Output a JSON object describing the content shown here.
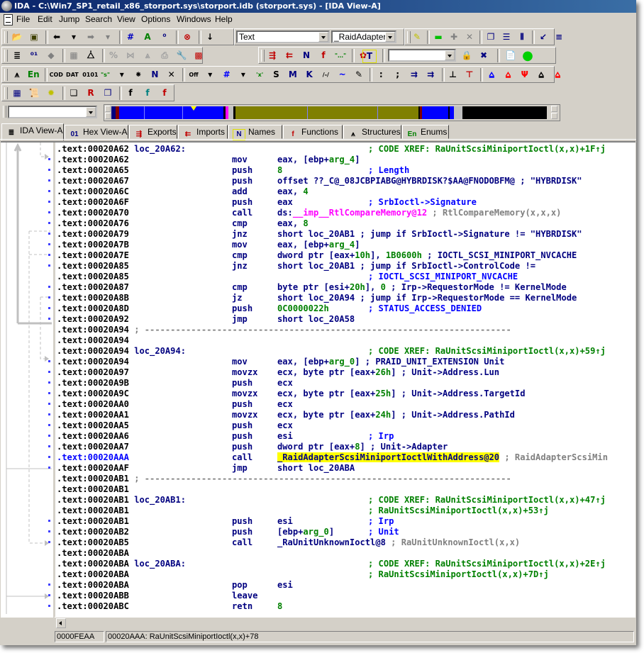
{
  "window": {
    "title": "IDA - C:\\Win7_SP1_retail_x86_storport.sys\\storport.idb (storport.sys) - [IDA View-A]"
  },
  "menu": [
    "File",
    "Edit",
    "Jump",
    "Search",
    "View",
    "Options",
    "Windows",
    "Help"
  ],
  "toolbar": {
    "row1": [
      {
        "name": "open-file-icon",
        "glyph": "📂",
        "color": "#c0a000"
      },
      {
        "name": "save-icon",
        "glyph": "▣",
        "color": "#404000"
      },
      {
        "name": "back-icon",
        "glyph": "⬅",
        "color": "#000000"
      },
      {
        "name": "back-dropdown-icon",
        "glyph": "▾",
        "color": "#000000"
      },
      {
        "name": "forward-icon",
        "glyph": "➡",
        "color": "#808080"
      },
      {
        "name": "forward-dropdown-icon",
        "glyph": "▾",
        "color": "#808080"
      },
      {
        "name": "search-text-icon",
        "glyph": "#",
        "color": "#0000c0"
      },
      {
        "name": "search-next-text-icon",
        "glyph": "A",
        "color": "#008000"
      },
      {
        "name": "search-binary-icon",
        "glyph": "⁰",
        "color": "#000080"
      },
      {
        "name": "search-immediate-icon",
        "glyph": "⊗",
        "color": "#c00000"
      },
      {
        "name": "jump-down-icon",
        "glyph": "↓",
        "color": "#000000"
      },
      {
        "name": "highlight-icon",
        "glyph": "✎",
        "color": "#c0c000"
      },
      {
        "name": "collapse-icon",
        "glyph": "▬",
        "color": "#00c000"
      },
      {
        "name": "expand-icon",
        "glyph": "✚",
        "color": "#808080"
      },
      {
        "name": "close-view-icon",
        "glyph": "✕",
        "color": "#808080"
      },
      {
        "name": "cascade-windows-icon",
        "glyph": "❐",
        "color": "#000080"
      },
      {
        "name": "tile-horizontal-icon",
        "glyph": "☰",
        "color": "#000080"
      },
      {
        "name": "tile-vertical-icon",
        "glyph": "⫴",
        "color": "#000080"
      },
      {
        "name": "window-arrow-icon",
        "glyph": "↙",
        "color": "#000080"
      },
      {
        "name": "list-icon",
        "glyph": "≡",
        "color": "#000080"
      }
    ],
    "row1_combo1": "Text",
    "row1_combo2": "_RaidAdapterS",
    "row2": [
      {
        "name": "disassembly-view-icon",
        "glyph": "≣",
        "color": "#000000"
      },
      {
        "name": "hex-view-icon",
        "glyph": "⁰¹",
        "color": "#000080"
      },
      {
        "name": "graph-node-icon",
        "glyph": "◆",
        "color": "#808080"
      },
      {
        "name": "flow-chart-icon",
        "glyph": "▦",
        "color": "#808080"
      },
      {
        "name": "call-graph-icon",
        "glyph": "⧊",
        "color": "#000000"
      },
      {
        "name": "percent-icon",
        "glyph": "%",
        "color": "#a0a0a0"
      },
      {
        "name": "xrefs-icon",
        "glyph": "⋈",
        "color": "#a0a0a0"
      },
      {
        "name": "tree-icon",
        "glyph": "⩓",
        "color": "#a0a0a0"
      },
      {
        "name": "print-icon",
        "glyph": "⎙",
        "color": "#a0a0a0"
      },
      {
        "name": "wrench-icon",
        "glyph": "🔧",
        "color": "#000000"
      },
      {
        "name": "color-palette-icon",
        "glyph": "▩",
        "color": "#c00000"
      },
      {
        "name": "exports-icon",
        "glyph": "⇶",
        "color": "#c00000"
      },
      {
        "name": "imports-icon",
        "glyph": "⇇",
        "color": "#c00000"
      },
      {
        "name": "names-icon",
        "glyph": "N",
        "color": "#000080"
      },
      {
        "name": "functions-icon",
        "glyph": "f",
        "color": "#c00000"
      },
      {
        "name": "strings-icon",
        "glyph": "\"…\"",
        "color": "#008000"
      },
      {
        "name": "flower-icon",
        "glyph": "✿",
        "color": "#c00000"
      },
      {
        "name": "type-icon",
        "glyph": "T",
        "color": "#000080"
      },
      {
        "name": "lock-icon",
        "glyph": "🔒",
        "color": "#000080"
      },
      {
        "name": "unlock-icon",
        "glyph": "✖",
        "color": "#000080"
      },
      {
        "name": "notepad-icon",
        "glyph": "📄",
        "color": "#c00000"
      },
      {
        "name": "status-ok-icon",
        "glyph": "●",
        "color": "#00d000"
      }
    ],
    "row3": [
      {
        "name": "structures-icon",
        "glyph": "⩚",
        "color": "#000000"
      },
      {
        "name": "enums-icon",
        "glyph": "En",
        "color": "#008000"
      },
      {
        "name": "make-code-icon",
        "glyph": "COD",
        "color": "#000000"
      },
      {
        "name": "make-data-icon",
        "glyph": "DAT",
        "color": "#000000"
      },
      {
        "name": "make-struct-icon",
        "glyph": "0101",
        "color": "#000000"
      },
      {
        "name": "make-string-icon",
        "glyph": "\"s\"",
        "color": "#008000"
      },
      {
        "name": "string-dropdown-icon",
        "glyph": "▾",
        "color": "#000000"
      },
      {
        "name": "make-array-icon",
        "glyph": "⁕",
        "color": "#000000"
      },
      {
        "name": "rename-icon",
        "glyph": "N",
        "color": "#000080"
      },
      {
        "name": "undefine-icon",
        "glyph": "✕",
        "color": "#000000"
      },
      {
        "name": "offset-icon",
        "glyph": "Off",
        "color": "#000000"
      },
      {
        "name": "offset-dropdown-icon",
        "glyph": "▾",
        "color": "#000000"
      },
      {
        "name": "number-icon",
        "glyph": "#",
        "color": "#0000ff"
      },
      {
        "name": "number-dropdown-icon",
        "glyph": "▾",
        "color": "#000000"
      },
      {
        "name": "char-icon",
        "glyph": "'x'",
        "color": "#008000"
      },
      {
        "name": "segment-icon",
        "glyph": "S",
        "color": "#000000"
      },
      {
        "name": "enum-member-icon",
        "glyph": "M",
        "color": "#000080"
      },
      {
        "name": "struct-offset-icon",
        "glyph": "K",
        "color": "#000080"
      },
      {
        "name": "negate-icon",
        "glyph": "/-/",
        "color": "#000000"
      },
      {
        "name": "bitwise-not-icon",
        "glyph": "~",
        "color": "#0000ff"
      },
      {
        "name": "edit-pencil-icon",
        "glyph": "✎",
        "color": "#000000"
      },
      {
        "name": "comment-icon",
        "glyph": ":",
        "color": "#000000"
      },
      {
        "name": "repeatable-comment-icon",
        "glyph": ";",
        "color": "#000000"
      },
      {
        "name": "anterior-lines-icon",
        "glyph": "⇉",
        "color": "#000080"
      },
      {
        "name": "posterior-lines-icon",
        "glyph": "⇉",
        "color": "#000080"
      },
      {
        "name": "xrefs-to-icon",
        "glyph": "⊥",
        "color": "#000000"
      },
      {
        "name": "xrefs-from-icon",
        "glyph": "⊤",
        "color": "#c00000"
      },
      {
        "name": "flow-graph-icon",
        "glyph": "⩠",
        "color": "#0000ff"
      },
      {
        "name": "call-graph-red-icon",
        "glyph": "⩠",
        "color": "#ff0000"
      },
      {
        "name": "xref-graph-to-icon",
        "glyph": "Ψ",
        "color": "#ff0000"
      },
      {
        "name": "xref-graph-from-icon",
        "glyph": "⩠",
        "color": "#000000"
      },
      {
        "name": "user-graph-icon",
        "glyph": "⩠",
        "color": "#ff0000"
      }
    ],
    "row4": [
      {
        "name": "calculator-icon",
        "glyph": "▦",
        "color": "#000080"
      },
      {
        "name": "script-icon",
        "glyph": "📜",
        "color": "#000080"
      },
      {
        "name": "gear-icon",
        "glyph": "✹",
        "color": "#c0c000"
      },
      {
        "name": "windows-stack-icon",
        "glyph": "❏",
        "color": "#000000"
      },
      {
        "name": "windows-red-icon",
        "glyph": "R",
        "color": "#c00000"
      },
      {
        "name": "windows-blue-icon",
        "glyph": "❐",
        "color": "#000080"
      },
      {
        "name": "function-icon",
        "glyph": "f",
        "color": "#000000"
      },
      {
        "name": "function-edit-icon",
        "glyph": "f",
        "color": "#008080"
      },
      {
        "name": "function-tail-icon",
        "glyph": "f",
        "color": "#c00000"
      }
    ]
  },
  "navband": {
    "combo_value": "",
    "segments": [
      {
        "color": "#000080",
        "w": 0.01
      },
      {
        "color": "#800000",
        "w": 0.008
      },
      {
        "color": "#0000ff",
        "w": 0.24
      },
      {
        "color": "#000000",
        "w": 0.005
      },
      {
        "color": "#ff00ff",
        "w": 0.005
      },
      {
        "color": "#c0c0c0",
        "w": 0.012
      },
      {
        "color": "#000000",
        "w": 0.005
      },
      {
        "color": "#808000",
        "w": 0.42
      },
      {
        "color": "#000000",
        "w": 0.004
      },
      {
        "color": "#800000",
        "w": 0.004
      },
      {
        "color": "#0000ff",
        "w": 0.06
      },
      {
        "color": "#000000",
        "w": 0.004
      },
      {
        "color": "#0000ff",
        "w": 0.01
      },
      {
        "color": "#c0c0c0",
        "w": 0.02
      },
      {
        "color": "#000000",
        "w": 0.193
      }
    ]
  },
  "tabs": [
    {
      "label": "IDA View-A",
      "icon": "disassembly-view-icon",
      "glyph": "≣",
      "color": "#000000",
      "active": true
    },
    {
      "label": "Hex View-A",
      "icon": "hex-view-icon",
      "glyph": "01",
      "color": "#000080",
      "active": false
    },
    {
      "label": "Exports",
      "icon": "exports-icon",
      "glyph": "⇶",
      "color": "#c00000",
      "active": false
    },
    {
      "label": "Imports",
      "icon": "imports-icon",
      "glyph": "⇇",
      "color": "#c00000",
      "active": false
    },
    {
      "label": "Names",
      "icon": "names-icon",
      "glyph": "N",
      "color": "#000080",
      "active": false
    },
    {
      "label": "Functions",
      "icon": "functions-icon",
      "glyph": "f",
      "color": "#c00000",
      "active": false
    },
    {
      "label": "Structures",
      "icon": "structures-icon",
      "glyph": "⩚",
      "color": "#000000",
      "active": false
    },
    {
      "label": "Enums",
      "icon": "enums-icon",
      "glyph": "En",
      "color": "#008000",
      "active": false
    }
  ],
  "code": [
    {
      "addr": ".text:00020A62",
      "label": "loc_20A62:",
      "cmt": "; CODE XREF: RaUnitScsiMiniportIoctl(x,x)+1F↑j",
      "cmtclass": "cmx",
      "dot": false
    },
    {
      "addr": ".text:00020A62",
      "mn": "mov",
      "op": [
        [
          "eax, [ebp+",
          ""
        ],
        [
          "arg_4",
          "num"
        ],
        [
          "]",
          ""
        ]
      ],
      "dot": true
    },
    {
      "addr": ".text:00020A65",
      "mn": "push",
      "op": [
        [
          "8",
          "num"
        ]
      ],
      "cmt": "; Length",
      "dot": true
    },
    {
      "addr": ".text:00020A67",
      "mn": "push",
      "op": [
        [
          "offset ??_C@_08JCBPIABG@HYBRDISK?$AA@FNODOBFM@ ; \"HYBRDISK\"",
          ""
        ]
      ],
      "dot": true
    },
    {
      "addr": ".text:00020A6C",
      "mn": "add",
      "op": [
        [
          "eax, ",
          ""
        ],
        [
          "4",
          "num"
        ]
      ],
      "dot": true
    },
    {
      "addr": ".text:00020A6F",
      "mn": "push",
      "op": [
        [
          "eax",
          ""
        ]
      ],
      "cmt": "; SrbIoctl->Signature",
      "dot": true
    },
    {
      "addr": ".text:00020A70",
      "mn": "call",
      "op": [
        [
          "ds:",
          ""
        ],
        [
          "__imp__RtlCompareMemory@12",
          "imp"
        ],
        [
          " ; RtlCompareMemory(x,x,x)",
          "cmg"
        ]
      ],
      "dot": true
    },
    {
      "addr": ".text:00020A76",
      "mn": "cmp",
      "op": [
        [
          "eax, ",
          ""
        ],
        [
          "8",
          "num"
        ]
      ],
      "dot": true
    },
    {
      "addr": ".text:00020A79",
      "mn": "jnz",
      "op": [
        [
          "short loc_20AB1 ; jump if SrbIoctl->Signature != \"HYBRDISK\"",
          ""
        ]
      ],
      "dot": true
    },
    {
      "addr": ".text:00020A7B",
      "mn": "mov",
      "op": [
        [
          "eax, [ebp+",
          ""
        ],
        [
          "arg_4",
          "num"
        ],
        [
          "]",
          ""
        ]
      ],
      "dot": true
    },
    {
      "addr": ".text:00020A7E",
      "mn": "cmp",
      "op": [
        [
          "dword ptr [eax+",
          ""
        ],
        [
          "10h",
          "num"
        ],
        [
          "], ",
          ""
        ],
        [
          "1B0600h",
          "num"
        ],
        [
          " ; IOCTL_SCSI_MINIPORT_NVCACHE",
          ""
        ]
      ],
      "dot": true
    },
    {
      "addr": ".text:00020A85",
      "mn": "jnz",
      "op": [
        [
          "short loc_20AB1 ; jump if SrbIoctl->ControlCode !=",
          ""
        ]
      ],
      "dot": true
    },
    {
      "addr": ".text:00020A85",
      "cmt": "; IOCTL_SCSI_MINIPORT_NVCACHE",
      "dot": false
    },
    {
      "addr": ".text:00020A87",
      "mn": "cmp",
      "op": [
        [
          "byte ptr [esi+",
          ""
        ],
        [
          "20h",
          "num"
        ],
        [
          "], ",
          ""
        ],
        [
          "0",
          "num"
        ],
        [
          " ; Irp->RequestorMode != KernelMode",
          ""
        ]
      ],
      "dot": true
    },
    {
      "addr": ".text:00020A8B",
      "mn": "jz",
      "op": [
        [
          "short loc_20A94 ; jump if Irp->RequestorMode == KernelMode",
          ""
        ]
      ],
      "dot": true
    },
    {
      "addr": ".text:00020A8D",
      "mn": "push",
      "op": [
        [
          "0C0000022h",
          "num"
        ]
      ],
      "cmt": "; STATUS_ACCESS_DENIED",
      "dot": true
    },
    {
      "addr": ".text:00020A92",
      "mn": "jmp",
      "op": [
        [
          "short loc_20A58",
          ""
        ]
      ],
      "dot": true
    },
    {
      "addr": ".text:00020A94",
      "sep": true,
      "dot": false
    },
    {
      "addr": ".text:00020A94",
      "dot": false
    },
    {
      "addr": ".text:00020A94",
      "label": "loc_20A94:",
      "cmt": "; CODE XREF: RaUnitScsiMiniportIoctl(x,x)+59↑j",
      "cmtclass": "cmx",
      "dot": false
    },
    {
      "addr": ".text:00020A94",
      "mn": "mov",
      "op": [
        [
          "eax, [ebp+",
          ""
        ],
        [
          "arg_0",
          "num"
        ],
        [
          "] ; PRAID_UNIT_EXTENSION Unit",
          ""
        ]
      ],
      "dot": true
    },
    {
      "addr": ".text:00020A97",
      "mn": "movzx",
      "op": [
        [
          "ecx, byte ptr [eax+",
          ""
        ],
        [
          "26h",
          "num"
        ],
        [
          "] ; Unit->Address.Lun",
          ""
        ]
      ],
      "dot": true
    },
    {
      "addr": ".text:00020A9B",
      "mn": "push",
      "op": [
        [
          "ecx",
          ""
        ]
      ],
      "dot": true
    },
    {
      "addr": ".text:00020A9C",
      "mn": "movzx",
      "op": [
        [
          "ecx, byte ptr [eax+",
          ""
        ],
        [
          "25h",
          "num"
        ],
        [
          "] ; Unit->Address.TargetId",
          ""
        ]
      ],
      "dot": true
    },
    {
      "addr": ".text:00020AA0",
      "mn": "push",
      "op": [
        [
          "ecx",
          ""
        ]
      ],
      "dot": true
    },
    {
      "addr": ".text:00020AA1",
      "mn": "movzx",
      "op": [
        [
          "ecx, byte ptr [eax+",
          ""
        ],
        [
          "24h",
          "num"
        ],
        [
          "] ; Unit->Address.PathId",
          ""
        ]
      ],
      "dot": true
    },
    {
      "addr": ".text:00020AA5",
      "mn": "push",
      "op": [
        [
          "ecx",
          ""
        ]
      ],
      "dot": true
    },
    {
      "addr": ".text:00020AA6",
      "mn": "push",
      "op": [
        [
          "esi",
          ""
        ]
      ],
      "cmt": "; Irp",
      "dot": true
    },
    {
      "addr": ".text:00020AA7",
      "mn": "push",
      "op": [
        [
          "dword ptr [eax+",
          ""
        ],
        [
          "8",
          "num"
        ],
        [
          "] ; Unit->Adapter",
          ""
        ]
      ],
      "dot": true
    },
    {
      "addr": ".text:00020AAA",
      "current": true,
      "mn": "call",
      "op": [
        [
          "_RaidAdapterScsiMiniportIoctlWithAddress@20",
          "hl"
        ],
        [
          " ; RaidAdapterScsiMin",
          "cmg"
        ]
      ],
      "dot": true
    },
    {
      "addr": ".text:00020AAF",
      "mn": "jmp",
      "op": [
        [
          "short loc_20ABA",
          ""
        ]
      ],
      "dot": true
    },
    {
      "addr": ".text:00020AB1",
      "sep": true,
      "dot": false
    },
    {
      "addr": ".text:00020AB1",
      "dot": false
    },
    {
      "addr": ".text:00020AB1",
      "label": "loc_20AB1:",
      "cmt": "; CODE XREF: RaUnitScsiMiniportIoctl(x,x)+47↑j",
      "cmtclass": "cmx",
      "dot": false
    },
    {
      "addr": ".text:00020AB1",
      "cmt": "; RaUnitScsiMiniportIoctl(x,x)+53↑j",
      "cmtclass": "cmx",
      "dot": false
    },
    {
      "addr": ".text:00020AB1",
      "mn": "push",
      "op": [
        [
          "esi",
          ""
        ]
      ],
      "cmt": "; Irp",
      "dot": true
    },
    {
      "addr": ".text:00020AB2",
      "mn": "push",
      "op": [
        [
          "[ebp+",
          ""
        ],
        [
          "arg_0",
          "num"
        ],
        [
          "]",
          ""
        ]
      ],
      "cmt": "; Unit",
      "dot": true
    },
    {
      "addr": ".text:00020AB5",
      "mn": "call",
      "op": [
        [
          "_RaUnitUnknownIoctl@8",
          ""
        ],
        [
          " ; RaUnitUnknownIoctl(x,x)",
          "cmg"
        ]
      ],
      "dot": true
    },
    {
      "addr": ".text:00020ABA",
      "dot": false
    },
    {
      "addr": ".text:00020ABA",
      "label": "loc_20ABA:",
      "cmt": "; CODE XREF: RaUnitScsiMiniportIoctl(x,x)+2E↑j",
      "cmtclass": "cmx",
      "dot": false
    },
    {
      "addr": ".text:00020ABA",
      "cmt": "; RaUnitScsiMiniportIoctl(x,x)+7D↑j",
      "cmtclass": "cmx",
      "dot": false
    },
    {
      "addr": ".text:00020ABA",
      "mn": "pop",
      "op": [
        [
          "esi",
          ""
        ]
      ],
      "dot": true
    },
    {
      "addr": ".text:00020ABB",
      "mn": "leave",
      "op": [],
      "dot": true
    },
    {
      "addr": ".text:00020ABC",
      "mn": "retn",
      "op": [
        [
          "8",
          "num"
        ]
      ],
      "dot": true
    }
  ],
  "status": {
    "offset": "0000FEAA",
    "location": "00020AAA: RaUnitScsiMiniportIoctl(x,x)+78"
  }
}
